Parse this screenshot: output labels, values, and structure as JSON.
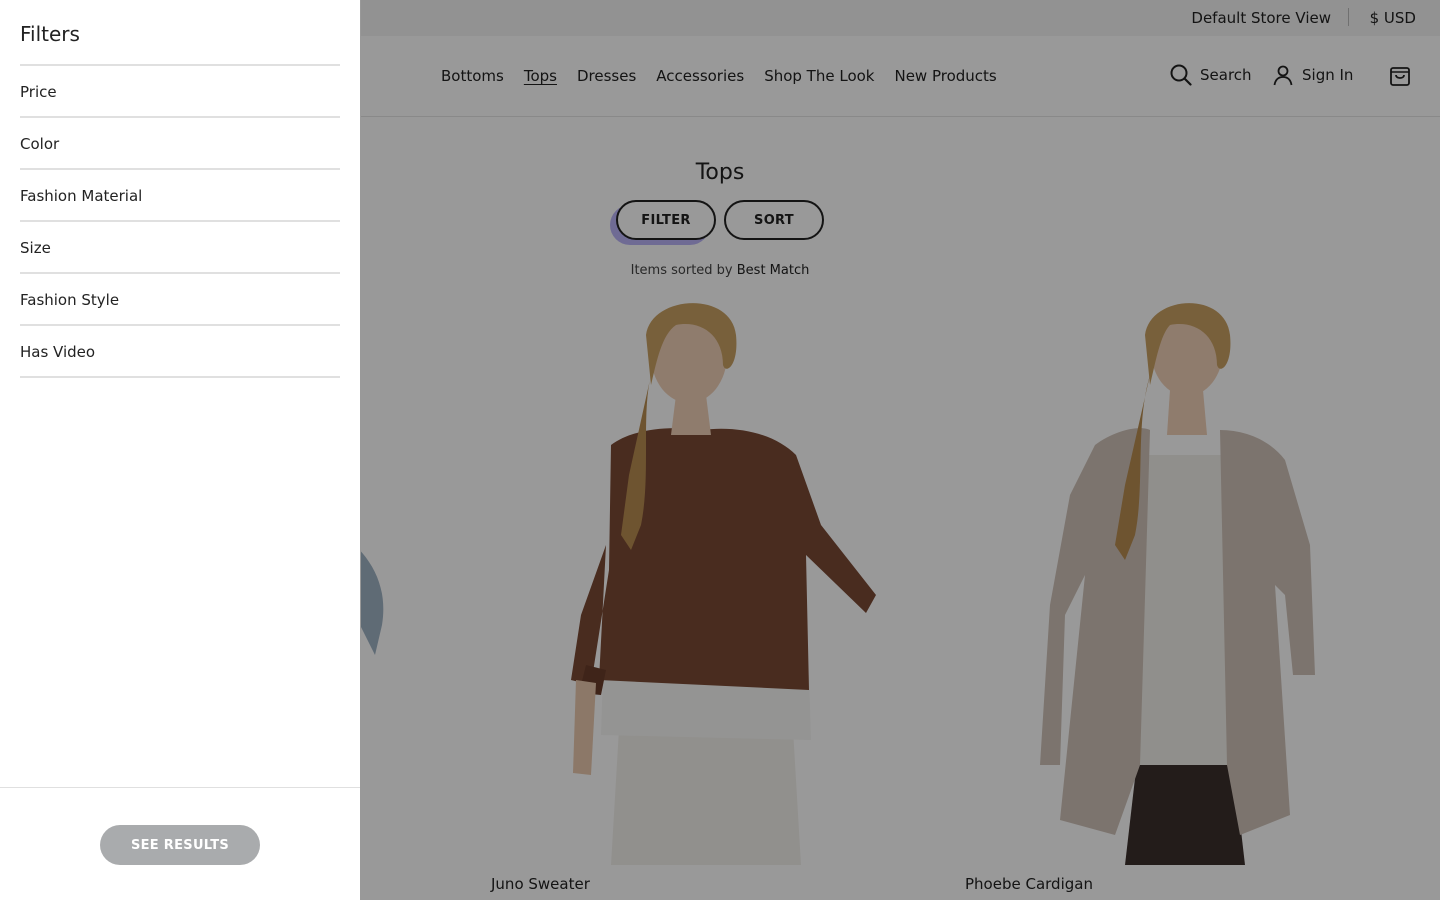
{
  "topbar": {
    "store_view": "Default Store View",
    "currency": "$  USD"
  },
  "nav": {
    "items": [
      "Bottoms",
      "Tops",
      "Dresses",
      "Accessories",
      "Shop The Look",
      "New Products"
    ],
    "active": "Tops"
  },
  "header_actions": {
    "search_label": "Search",
    "signin_label": "Sign In"
  },
  "listing": {
    "title": "Tops",
    "filter_label": "FILTER",
    "sort_label": "SORT",
    "sorted_prefix": "Items sorted by",
    "sorted_value": "Best Match",
    "products": [
      {
        "name": "Juno Sweater"
      },
      {
        "name": "Phoebe Cardigan"
      }
    ]
  },
  "drawer": {
    "title": "Filters",
    "filters": [
      "Price",
      "Color",
      "Fashion Material",
      "Size",
      "Fashion Style",
      "Has Video"
    ],
    "see_results_label": "SEE RESULTS"
  },
  "colors": {
    "overlay": "#666666",
    "see_results_bg": "#a9abad",
    "filter_focus": "#b9b3f7"
  }
}
